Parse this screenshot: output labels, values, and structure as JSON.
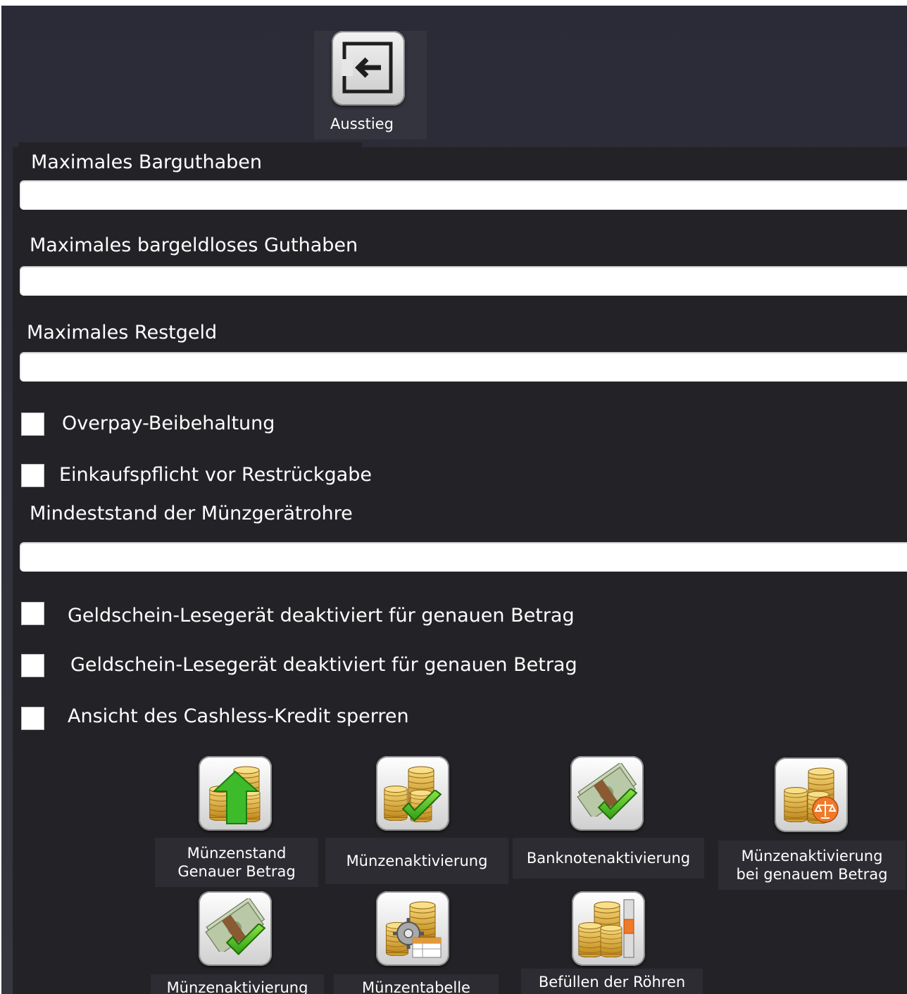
{
  "header": {
    "exit_label": "Ausstieg",
    "exit_icon": "exit-icon"
  },
  "fields": {
    "max_cash_credit": {
      "label": "Maximales Barguthaben",
      "value": ""
    },
    "max_cashless_credit": {
      "label": "Maximales bargeldloses Guthaben",
      "value": ""
    },
    "max_change": {
      "label": "Maximales Restgeld",
      "value": ""
    },
    "min_coin_tube_level": {
      "label": "Mindeststand der Münzgerätrohre",
      "value": ""
    }
  },
  "checkboxes": {
    "overpay_retention": {
      "label": "Overpay-Beibehaltung",
      "checked": false
    },
    "purchase_before_change": {
      "label": "Einkaufspflicht vor Restrückgabe",
      "checked": false
    },
    "bill_reader_exact_1": {
      "label": "Geldschein-Lesegerät deaktiviert für genauen Betrag",
      "checked": false
    },
    "bill_reader_exact_2": {
      "label": "Geldschein-Lesegerät deaktiviert für genauen Betrag",
      "checked": false
    },
    "hide_cashless_credit": {
      "label": "Ansicht des Cashless-Kredit sperren",
      "checked": false
    }
  },
  "tiles": {
    "coin_level_exact": {
      "line1": "Münzenstand",
      "line2": "Genauer Betrag",
      "icon": "coins-arrow-up-icon"
    },
    "coin_activation": {
      "line1": "Münzenaktivierung",
      "icon": "coins-checkmark-icon"
    },
    "banknote_activation": {
      "line1": "Banknotenaktivierung",
      "icon": "banknote-checkmark-icon"
    },
    "coin_activation_exact": {
      "line1": "Münzenaktivierung",
      "line2": "bei genauem Betrag",
      "icon": "coins-scale-icon"
    },
    "coin_activation_2": {
      "line1": "Münzenaktivierung",
      "icon": "banknote-checkmark-icon"
    },
    "coin_table": {
      "line1": "Münzentabelle",
      "icon": "coins-gear-table-icon"
    },
    "fill_tubes": {
      "line1": "Befüllen der Röhren",
      "icon": "coins-tube-icon"
    }
  },
  "colors": {
    "background": "#2f2f3a",
    "panel": "#232327",
    "label_bg": "#2c2c32",
    "coin_gold": "#e0b43c",
    "check_green": "#4cc21a",
    "arrow_green": "#3dbb2a",
    "scale_orange": "#f07a2a"
  }
}
